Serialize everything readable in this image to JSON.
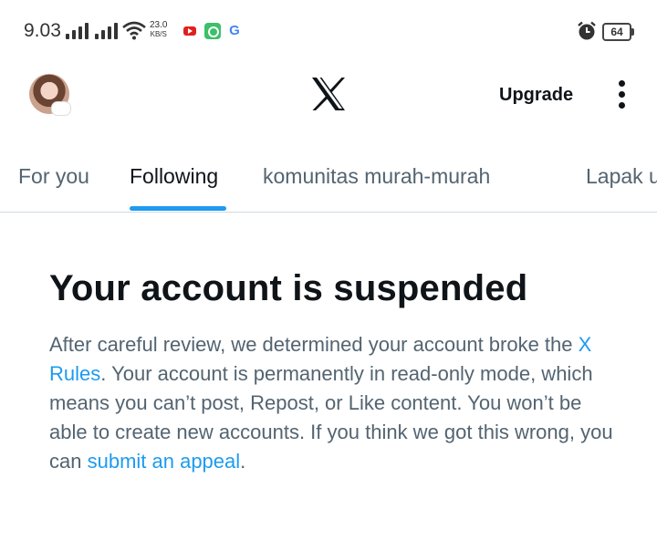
{
  "status_bar": {
    "time": "9.03",
    "speed_value": "23.0",
    "speed_unit": "KB/S",
    "google_letter": "G",
    "battery": "64"
  },
  "header": {
    "upgrade_label": "Upgrade",
    "logo_icon": "x-logo-icon",
    "more_icon": "more-vertical-icon"
  },
  "tabs": [
    {
      "label": "For you"
    },
    {
      "label": "Following"
    },
    {
      "label": "komunitas murah-murah"
    },
    {
      "label": "Lapak u"
    }
  ],
  "notice": {
    "title": "Your account is suspended",
    "text_1": "After careful review, we determined your account broke the ",
    "rules_link": "X Rules",
    "text_2": ". Your account is permanently in read-only mode, which means you can’t post, Repost, or Like content. You won’t be able to create new accounts. If you think we got this wrong, you can ",
    "appeal_link": "submit an appeal",
    "text_3": "."
  },
  "colors": {
    "accent": "#1d9bf0",
    "text_primary": "#0f1419",
    "text_secondary": "#536471",
    "divider": "#cfd9de"
  }
}
